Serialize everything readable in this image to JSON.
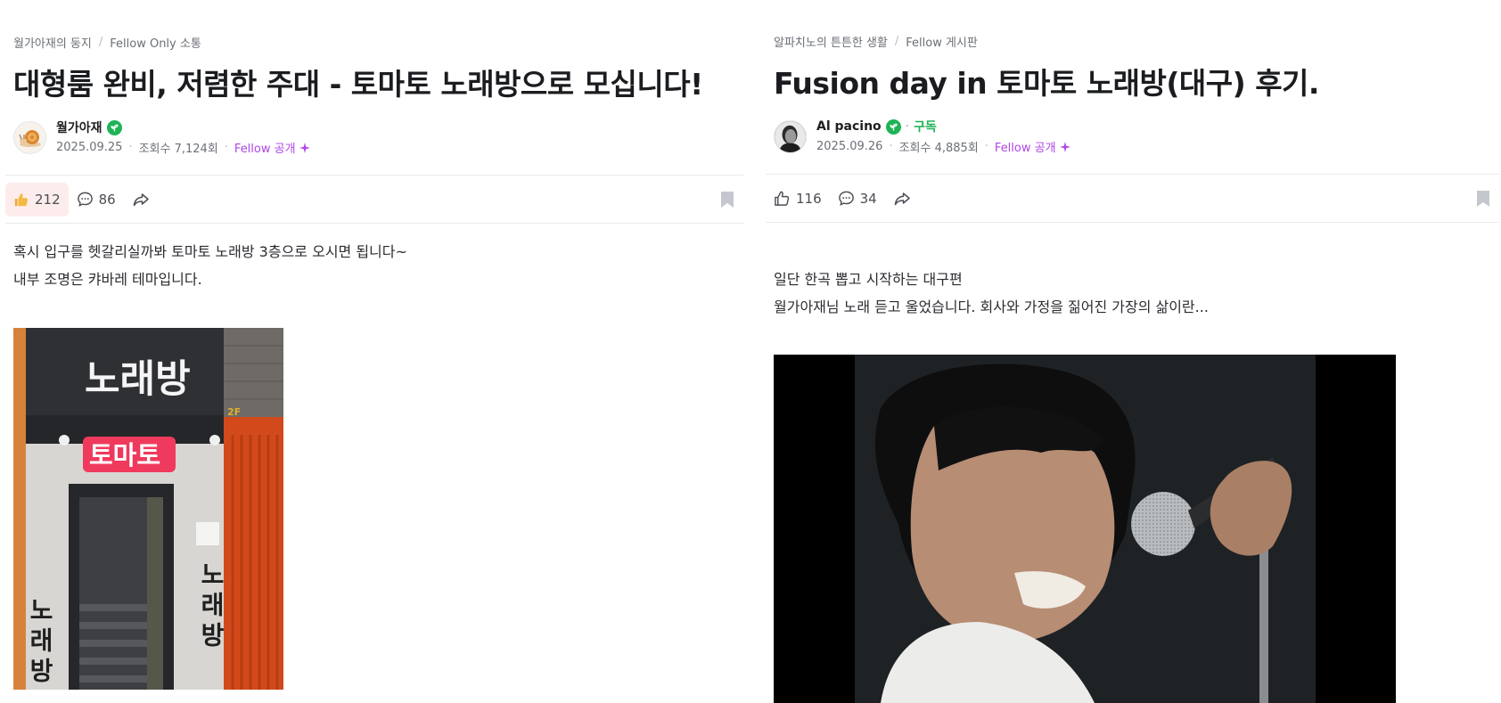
{
  "posts": [
    {
      "breadcrumb": {
        "community": "월가아재의 둥지",
        "board": "Fellow Only 소통"
      },
      "title": "대형룸 완비, 저렴한 주대 - 토마토 노래방으로 모십니다!",
      "author": {
        "name": "월가아재",
        "date": "2025.09.25",
        "views": "조회수 7,124회",
        "visibility": "Fellow 공개"
      },
      "actions": {
        "likes": "212",
        "comments": "86"
      },
      "body": [
        "혹시 입구를 헷갈리실까봐 토마토 노래방 3층으로 오시면 됩니다~",
        "내부 조명은 캬바레 테마입니다."
      ],
      "photo": {
        "sign_top": "노래방",
        "sign_main": "토마토",
        "vertical_left": "노래방",
        "vertical_right": "노래방",
        "floor": "2F"
      }
    },
    {
      "breadcrumb": {
        "community": "알파치노의 튼튼한 생활",
        "board": "Fellow 게시판"
      },
      "title": "Fusion day in 토마토 노래방(대구) 후기.",
      "author": {
        "name": "Al pacino",
        "subscribe": "구독",
        "date": "2025.09.26",
        "views": "조회수 4,885회",
        "visibility": "Fellow 공개"
      },
      "actions": {
        "likes": "116",
        "comments": "34"
      },
      "body": [
        "일단 한곡 뽑고 시작하는 대구편",
        "월가아재님 노래 듣고 울었습니다. 회사와 가정을 짊어진 가장의 삶이란..."
      ]
    }
  ],
  "icons": {
    "badge": "fellow-badge-icon",
    "like": "thumbs-up-icon",
    "comment": "comment-icon",
    "share": "share-icon",
    "bookmark": "bookmark-icon",
    "fellow": "sparkle-icon"
  },
  "colors": {
    "fellow": "#b045e6",
    "badge": "#1fb356",
    "liked_bg": "#fdecec"
  }
}
